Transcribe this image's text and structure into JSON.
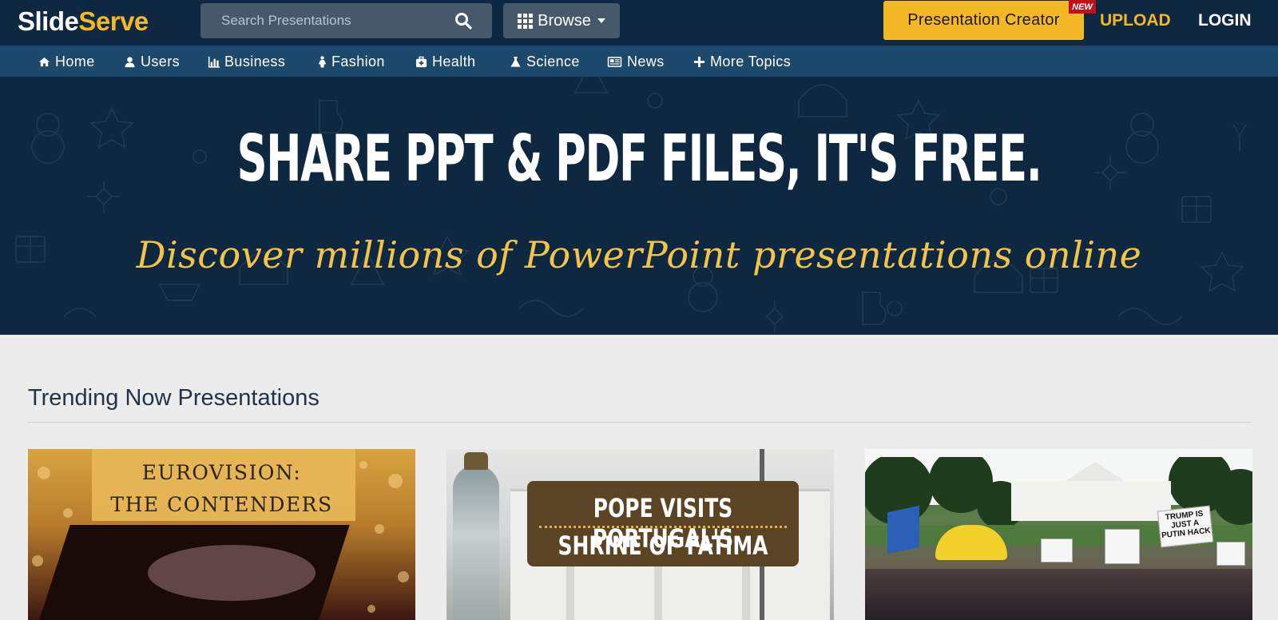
{
  "header": {
    "logo": {
      "part1": "Slide",
      "part2": "Serve"
    },
    "search": {
      "placeholder": "Search Presentations"
    },
    "browse_label": "Browse",
    "creator_label": "Presentation Creator",
    "new_badge": "NEW",
    "upload_label": "UPLOAD",
    "login_label": "LOGIN"
  },
  "nav": {
    "items": [
      {
        "label": "Home",
        "icon": "home-icon"
      },
      {
        "label": "Users",
        "icon": "user-icon"
      },
      {
        "label": "Business",
        "icon": "bar-chart-icon"
      },
      {
        "label": "Fashion",
        "icon": "female-icon"
      },
      {
        "label": "Health",
        "icon": "medkit-icon"
      },
      {
        "label": "Science",
        "icon": "flask-icon"
      },
      {
        "label": "News",
        "icon": "newspaper-icon"
      },
      {
        "label": "More Topics",
        "icon": "plus-icon"
      }
    ]
  },
  "hero": {
    "title": "SHARE PPT & PDF FILES, IT'S FREE.",
    "subtitle": "Discover millions of PowerPoint presentations online"
  },
  "trending": {
    "title": "Trending Now Presentations",
    "cards": [
      {
        "line1": "EUROVISION:",
        "line2": "THE CONTENDERS"
      },
      {
        "line1": "POPE VISITS PORTUGAL'S",
        "line2": "SHRINE OF FATIMA"
      },
      {
        "sign1": "TRUMP IS JUST A PUTIN HACK"
      }
    ]
  },
  "colors": {
    "topbar": "#0d2840",
    "navbar": "#1d4a6c",
    "accent": "#f4b827",
    "badge": "#c0111b"
  }
}
